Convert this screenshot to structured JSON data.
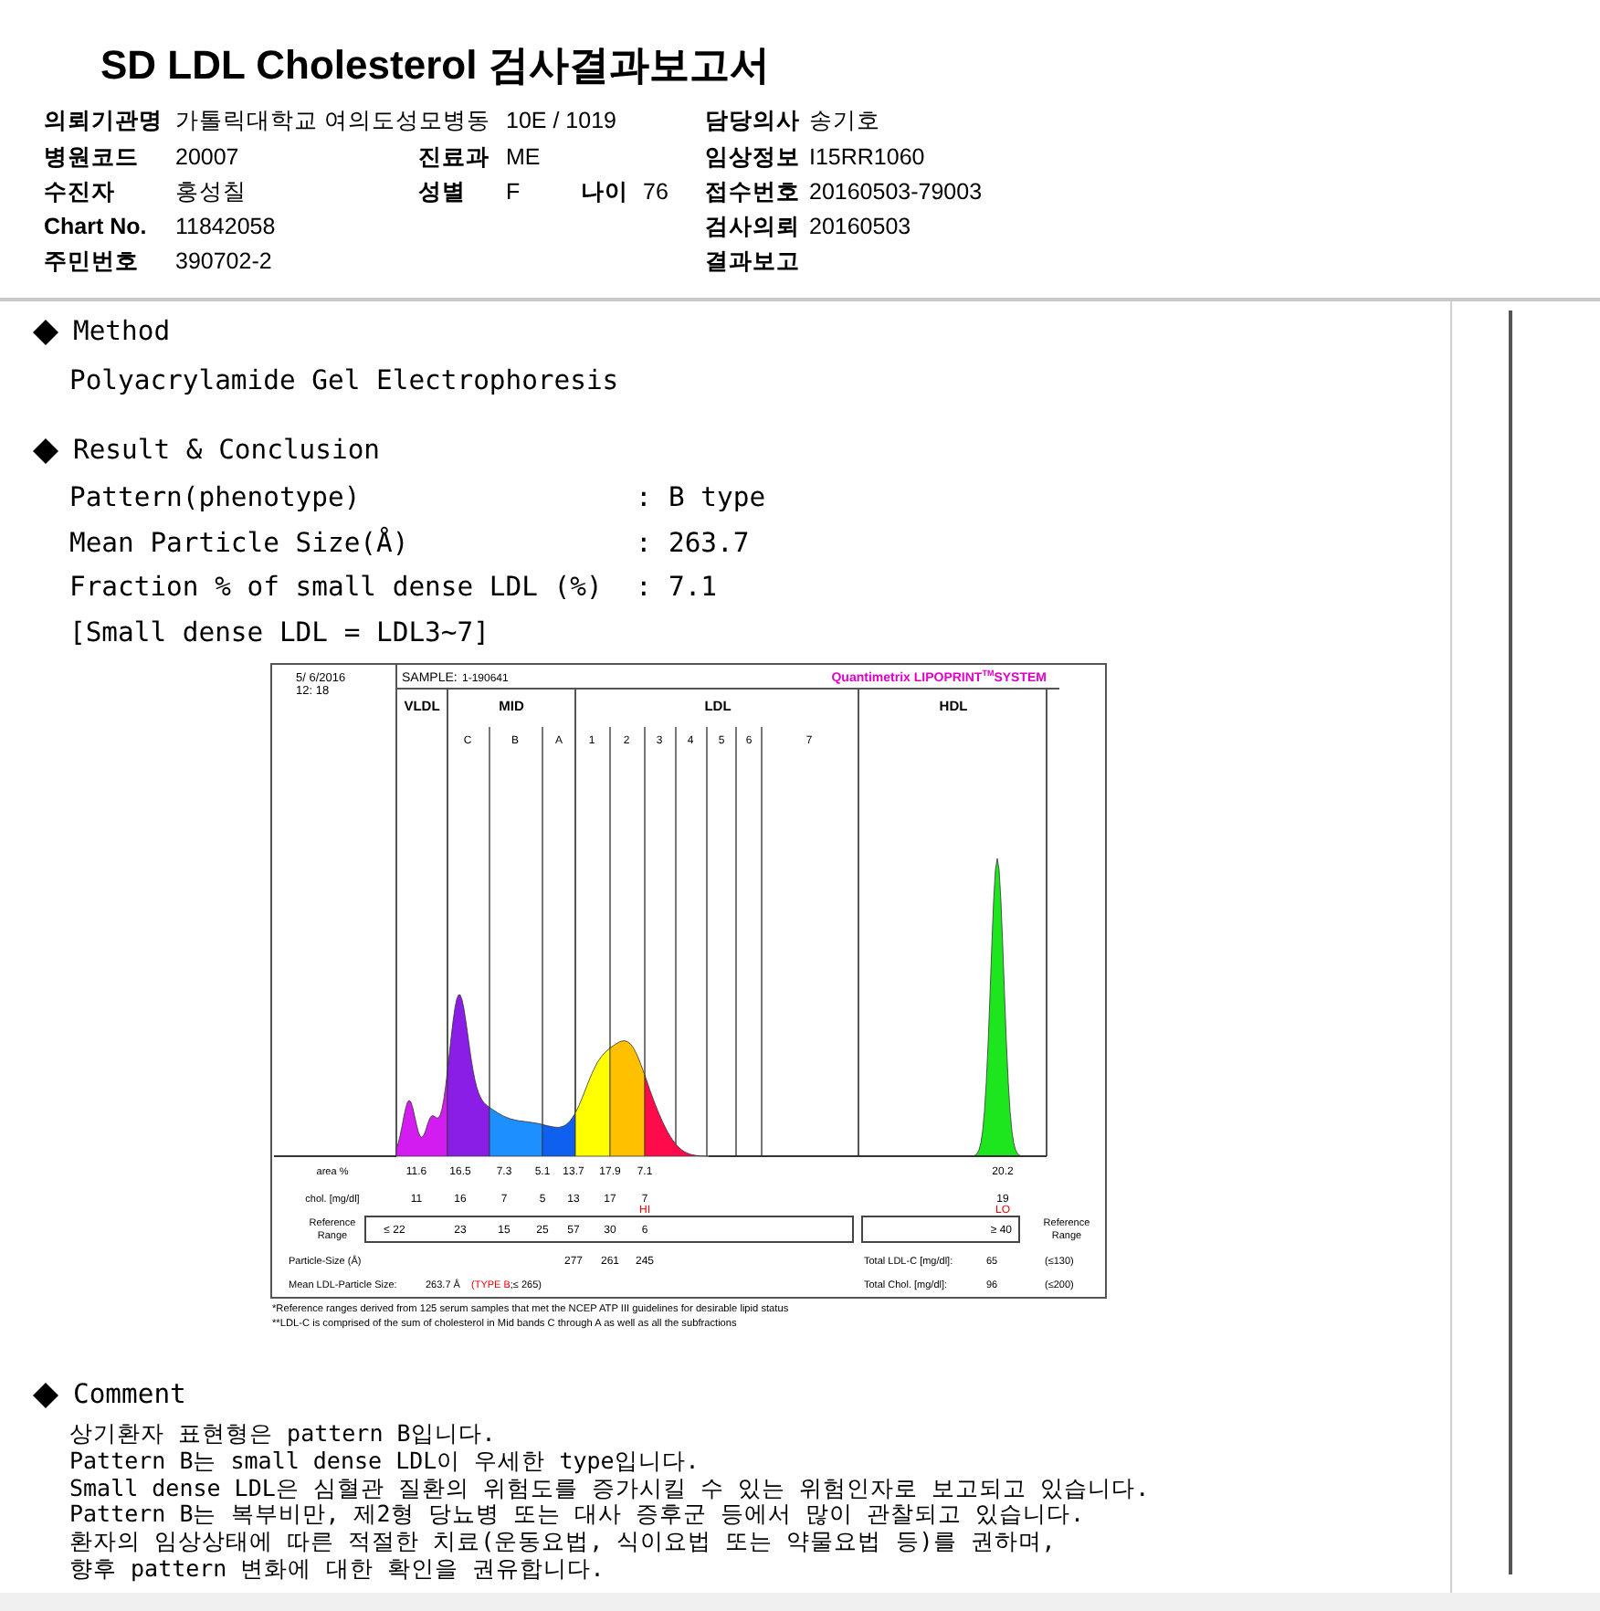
{
  "title": "SD LDL Cholesterol 검사결과보고서",
  "info_rows": [
    {
      "main": {
        "label": "의뢰기관명",
        "value": "가톨릭대학교 여의도성모병동"
      },
      "extras": [
        {
          "value": "10E / 1019"
        }
      ],
      "side": {
        "label": "담당의사",
        "value": "송기호"
      }
    },
    {
      "main": {
        "label": "병원코드",
        "value": "20007"
      },
      "extras": [
        {
          "label": "진료과",
          "value": "ME"
        }
      ],
      "side": {
        "label": "임상정보",
        "value": "I15RR1060"
      }
    },
    {
      "main": {
        "label": "수진자",
        "value": "홍성칠"
      },
      "extras": [
        {
          "label": "성별",
          "value": "F"
        },
        {
          "label": "나이",
          "value": "76"
        }
      ],
      "side": {
        "label": "접수번호",
        "value": "20160503-79003"
      }
    },
    {
      "main": {
        "label": "Chart No.",
        "value": "11842058"
      },
      "extras": [],
      "side": {
        "label": "검사의뢰",
        "value": "20160503"
      }
    },
    {
      "main": {
        "label": "주민번호",
        "value": "390702-2"
      },
      "extras": [],
      "side": {
        "label": "결과보고"
      }
    }
  ],
  "method": {
    "heading": "Method",
    "text": "Polyacrylamide Gel Electrophoresis"
  },
  "result": {
    "heading": "Result & Conclusion",
    "rows": [
      {
        "label": "Pattern(phenotype)",
        "separator": ":",
        "value": "B type"
      },
      {
        "label": "Mean Particle Size(Å)",
        "separator": ":",
        "value": "263.7"
      },
      {
        "label": "Fraction % of small dense LDL (%)",
        "separator": ":",
        "value": "7.1"
      }
    ],
    "note": "[Small dense LDL = LDL3~7]"
  },
  "chart": {
    "date": "5/ 6/2016",
    "time": "12: 18",
    "sample_label": "SAMPLE:",
    "sample_id": "1-190641",
    "brand": "Quantimetrix LIPOPRINT",
    "brand_mark": "TM",
    "brand_suffix": "SYSTEM",
    "groups": [
      "VLDL",
      "MID",
      "LDL",
      "HDL"
    ],
    "bands": [
      "C",
      "B",
      "A",
      "1",
      "2",
      "3",
      "4",
      "5",
      "6",
      "7"
    ],
    "area": {
      "label": "area %",
      "values": [
        "11.6",
        "16.5",
        "7.3",
        "5.1",
        "13.7",
        "17.9",
        "7.1"
      ],
      "hdl": "20.2"
    },
    "chol": {
      "label": "chol. [mg/dl]",
      "values": [
        "11",
        "16",
        "7",
        "5",
        "13",
        "17",
        "7"
      ],
      "flag": "HI",
      "hdl": "19",
      "hdl_flag": "LO"
    },
    "reference": {
      "label_lines": [
        "Reference",
        "Range"
      ],
      "values": [
        "≤ 22",
        "23",
        "15",
        "25",
        "57",
        "30",
        "6"
      ],
      "hdl": "≥ 40",
      "hdl_label_lines": [
        "Reference",
        "Range"
      ]
    },
    "particle": {
      "label": "Particle-Size (Å)",
      "values": [
        "277",
        "261",
        "245"
      ]
    },
    "mean": {
      "label": "Mean LDL-Particle Size:",
      "value": "263.7 Å",
      "type": "(TYPE B",
      "limit": ";≤ 265)"
    },
    "totals": [
      {
        "label": "Total LDL-C [mg/dl]:",
        "value": "65",
        "limit": "(≤130)"
      },
      {
        "label": "Total Chol. [mg/dl]:",
        "value": "96",
        "limit": "(≤200)"
      }
    ],
    "footnotes": [
      "*Reference ranges derived from 125 serum samples that met the NCEP ATP III guidelines for desirable lipid status",
      "**LDL-C is comprised of the sum of cholesterol in Mid bands C through A as well as all the subfractions"
    ]
  },
  "comment": {
    "heading": "Comment",
    "lines": [
      "상기환자 표현형은 pattern B입니다.",
      "Pattern B는 small dense LDL이 우세한 type입니다.",
      "Small dense LDL은 심혈관 질환의 위험도를 증가시킬 수 있는 위험인자로 보고되고 있습니다.",
      "Pattern B는 복부비만, 제2형 당뇨병 또는 대사 증후군 등에서 많이 관찰되고 있습니다.",
      "환자의 임상상태에 따른 적절한 치료(운동요법, 식이요법 또는 약물요법 등)를 권하며,",
      "향후 pattern 변화에 대한 확인을 권유합니다."
    ]
  }
}
